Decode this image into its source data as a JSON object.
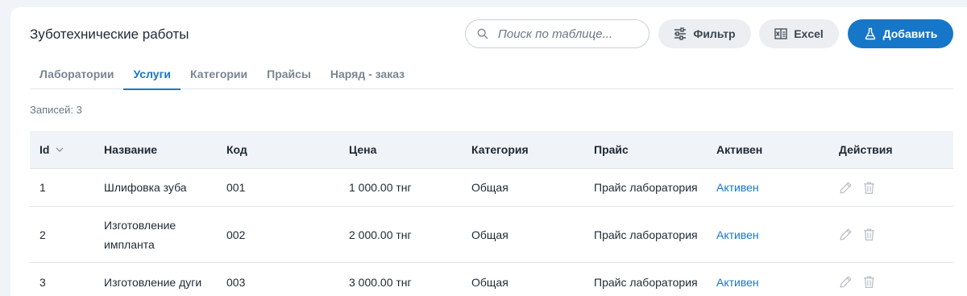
{
  "header": {
    "title": "Зуботехнические работы",
    "search_placeholder": "Поиск по таблице...",
    "filter_label": "Фильтр",
    "excel_label": "Excel",
    "add_label": "Добавить"
  },
  "tabs": [
    {
      "label": "Лаборатории",
      "active": false
    },
    {
      "label": "Услуги",
      "active": true
    },
    {
      "label": "Категории",
      "active": false
    },
    {
      "label": "Прайсы",
      "active": false
    },
    {
      "label": "Наряд - заказ",
      "active": false
    }
  ],
  "records_label": "Записей: 3",
  "table": {
    "columns": [
      "Id",
      "Название",
      "Код",
      "Цена",
      "Категория",
      "Прайс",
      "Активен",
      "Действия"
    ],
    "rows": [
      {
        "id": "1",
        "name": "Шлифовка зуба",
        "code": "001",
        "price": "1 000.00 тнг",
        "category": "Общая",
        "price_list": "Прайс лаборатория",
        "active": "Активен"
      },
      {
        "id": "2",
        "name": "Изготовление импланта",
        "code": "002",
        "price": "2 000.00 тнг",
        "category": "Общая",
        "price_list": "Прайс лаборатория",
        "active": "Активен"
      },
      {
        "id": "3",
        "name": "Изготовление дуги",
        "code": "003",
        "price": "3 000.00 тнг",
        "category": "Общая",
        "price_list": "Прайс лаборатория",
        "active": "Активен"
      }
    ]
  },
  "colors": {
    "accent": "#1677c9",
    "background": "#f0f3f8",
    "secondary_button": "#eceef1",
    "muted_icon": "#b9c0c8"
  },
  "icons": {
    "search": "search-icon",
    "filter": "sliders-icon",
    "excel": "excel-icon",
    "add": "flask-icon",
    "sort": "chevron-down-icon",
    "edit": "pencil-icon",
    "delete": "trash-icon"
  }
}
